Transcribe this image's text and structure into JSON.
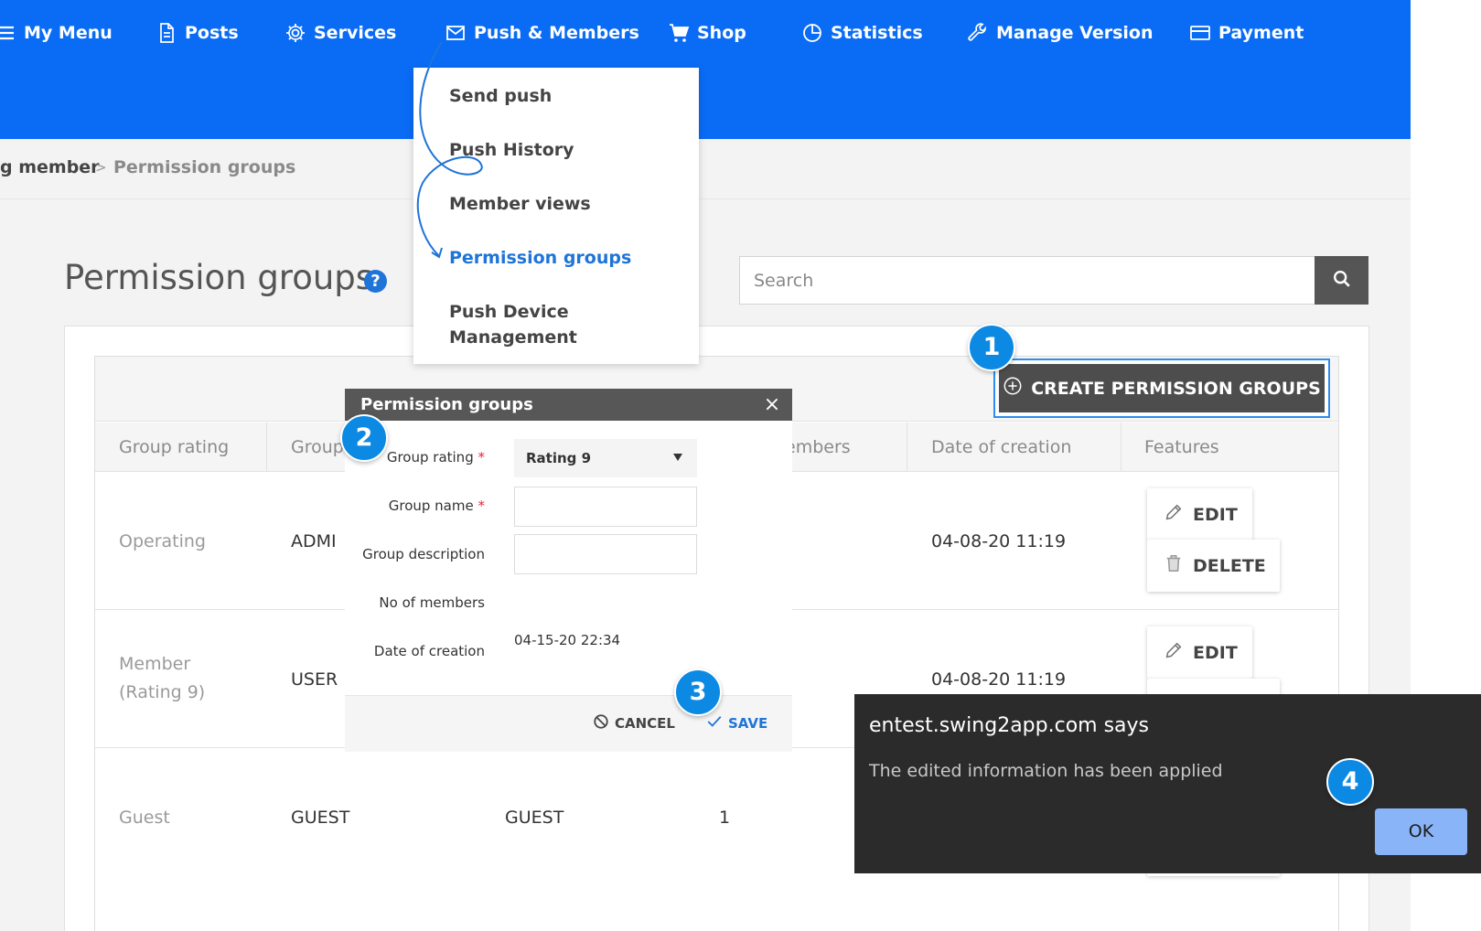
{
  "nav": {
    "items": [
      {
        "label": "My Menu",
        "icon": "menu-icon"
      },
      {
        "label": "Posts",
        "icon": "document-icon"
      },
      {
        "label": "Services",
        "icon": "gear-icon"
      },
      {
        "label": "Push & Members",
        "icon": "envelope-icon"
      },
      {
        "label": "Shop",
        "icon": "cart-icon"
      },
      {
        "label": "Statistics",
        "icon": "pie-chart-icon"
      },
      {
        "label": "Manage Version",
        "icon": "wrench-icon"
      },
      {
        "label": "Payment",
        "icon": "card-icon"
      }
    ]
  },
  "dropdown": {
    "items": [
      "Send push",
      "Push History",
      "Member views",
      "Permission groups",
      "Push Device",
      "Management"
    ],
    "active": "Permission groups"
  },
  "breadcrumb": {
    "parent": "g member",
    "separator": ">",
    "current": "Permission groups"
  },
  "page": {
    "title": "Permission groups",
    "help": "?"
  },
  "search": {
    "placeholder": "Search"
  },
  "toolbar": {
    "create_label": "CREATE PERMISSION GROUPS"
  },
  "table": {
    "headers": [
      "Group rating",
      "Group",
      "embers",
      "Date of creation",
      "Features"
    ],
    "rows": [
      {
        "rating": "Operating",
        "group": "ADMI",
        "name": "",
        "members": "",
        "date": "04-08-20 11:19"
      },
      {
        "rating_line1": "Member",
        "rating_line2": "(Rating 9)",
        "group": "USER",
        "name": "",
        "members": "",
        "date": "04-08-20 11:19"
      },
      {
        "rating": "Guest",
        "group": "GUEST",
        "name": "GUEST",
        "members": "1",
        "date": ""
      }
    ],
    "edit_label": "EDIT",
    "delete_label": "DELETE"
  },
  "modal": {
    "title": "Permission groups",
    "close": "×",
    "fields": {
      "group_rating_label": "Group rating",
      "group_rating_value": "Rating 9",
      "group_name_label": "Group name",
      "group_description_label": "Group description",
      "members_label": "No of members",
      "date_label": "Date of creation",
      "date_value": "04-15-20 22:34",
      "required_mark": "*"
    },
    "cancel_label": "CANCEL",
    "save_label": "SAVE"
  },
  "alert": {
    "title": "entest.swing2app.com says",
    "message": "The edited information has been applied",
    "ok_label": "OK"
  },
  "badges": [
    "1",
    "2",
    "3",
    "4"
  ],
  "colors": {
    "brand_blue": "#0a6cf5",
    "accent_blue": "#1f74d8",
    "badge_blue": "#0c8ae3",
    "dark_button": "#4d4d4d",
    "alert_bg": "#2b2b2b",
    "ok_button": "#8ab4f8"
  }
}
